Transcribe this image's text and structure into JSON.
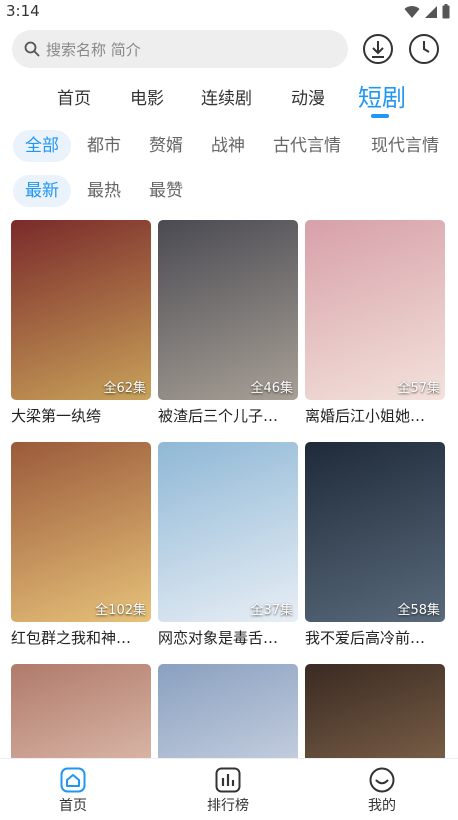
{
  "status_bar": {
    "time": "3:14"
  },
  "search": {
    "placeholder": "搜索名称 简介"
  },
  "main_tabs": [
    {
      "label": "首页",
      "active": false
    },
    {
      "label": "电影",
      "active": false
    },
    {
      "label": "连续剧",
      "active": false
    },
    {
      "label": "动漫",
      "active": false
    },
    {
      "label": "短剧",
      "active": true
    }
  ],
  "genre_filters": [
    {
      "label": "全部",
      "active": true
    },
    {
      "label": "都市",
      "active": false
    },
    {
      "label": "赘婿",
      "active": false
    },
    {
      "label": "战神",
      "active": false
    },
    {
      "label": "古代言情",
      "active": false
    },
    {
      "label": "现代言情",
      "active": false
    }
  ],
  "sort_filters": [
    {
      "label": "最新",
      "active": true
    },
    {
      "label": "最热",
      "active": false
    },
    {
      "label": "最赞",
      "active": false
    }
  ],
  "items": [
    {
      "title": "大梁第一纨绔",
      "episodes": "全62集",
      "art": {
        "bg1": "#7a2a2a",
        "bg2": "#c9a25a"
      }
    },
    {
      "title": "被渣后三个儿子…",
      "episodes": "全46集",
      "art": {
        "bg1": "#4a4a52",
        "bg2": "#a8a096"
      }
    },
    {
      "title": "离婚后江小姐她…",
      "episodes": "全57集",
      "art": {
        "bg1": "#d7a0a8",
        "bg2": "#f3e2dc"
      }
    },
    {
      "title": "红包群之我和神…",
      "episodes": "全102集",
      "art": {
        "bg1": "#9a5a3a",
        "bg2": "#e7c27a"
      }
    },
    {
      "title": "网恋对象是毒舌…",
      "episodes": "全37集",
      "art": {
        "bg1": "#8fb8d6",
        "bg2": "#e8eef5"
      }
    },
    {
      "title": "我不爱后高冷前…",
      "episodes": "全58集",
      "art": {
        "bg1": "#1e2a3a",
        "bg2": "#5a6a7a"
      }
    },
    {
      "title": "",
      "episodes": "",
      "art": {
        "bg1": "#b07a6a",
        "bg2": "#efd6c8"
      }
    },
    {
      "title": "",
      "episodes": "",
      "art": {
        "bg1": "#8aa0c0",
        "bg2": "#e2e6ee"
      }
    },
    {
      "title": "",
      "episodes": "",
      "art": {
        "bg1": "#3a2a22",
        "bg2": "#9a7a5a"
      }
    }
  ],
  "bottom_nav": [
    {
      "label": "首页",
      "icon": "home-icon",
      "active": true
    },
    {
      "label": "排行榜",
      "icon": "chart-icon",
      "active": false
    },
    {
      "label": "我的",
      "icon": "profile-icon",
      "active": false
    }
  ],
  "colors": {
    "accent": "#2196f3",
    "chip_bg": "#eaf3fc"
  }
}
